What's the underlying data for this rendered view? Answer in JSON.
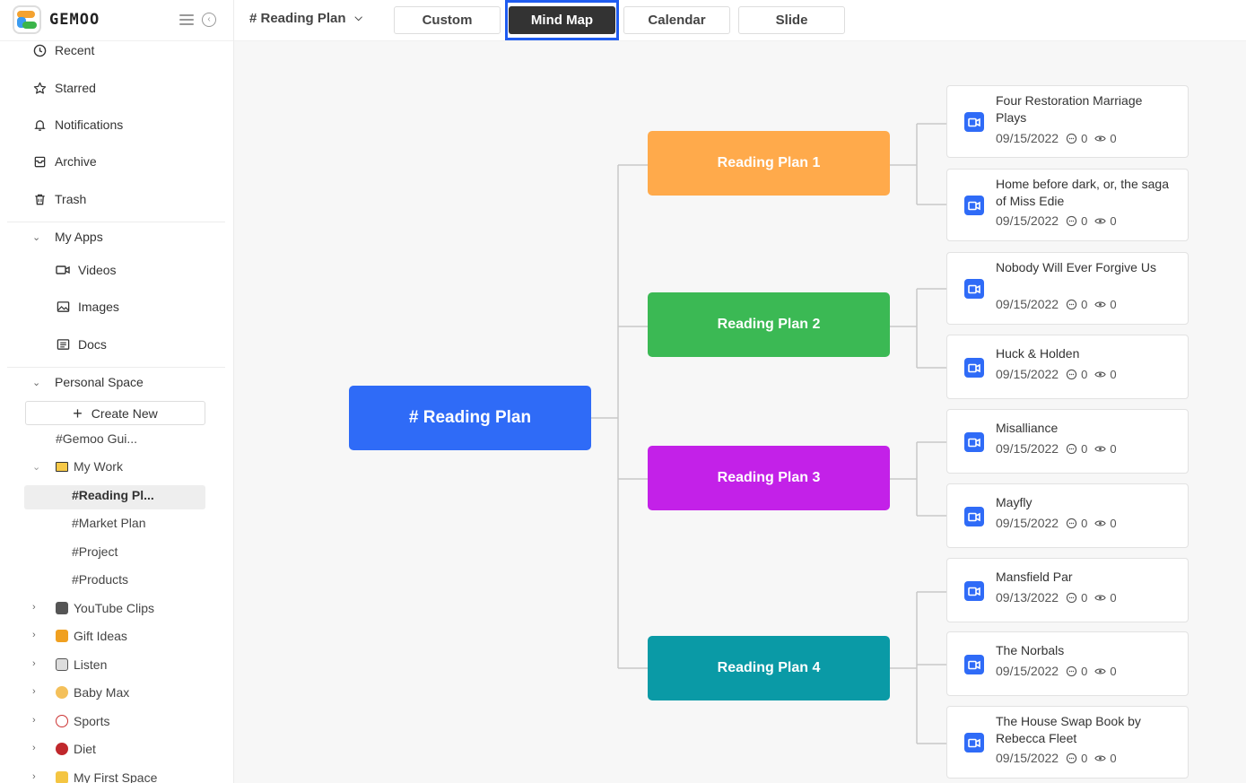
{
  "app": {
    "logo_text": "GEMOO"
  },
  "sidebar": {
    "nav": [
      {
        "label": "Recent",
        "icon": "clock-icon"
      },
      {
        "label": "Starred",
        "icon": "star-icon"
      },
      {
        "label": "Notifications",
        "icon": "bell-icon"
      },
      {
        "label": "Archive",
        "icon": "archive-icon"
      },
      {
        "label": "Trash",
        "icon": "trash-icon"
      }
    ],
    "my_apps": {
      "label": "My Apps",
      "items": [
        {
          "label": "Videos",
          "icon": "video-icon"
        },
        {
          "label": "Images",
          "icon": "image-icon"
        },
        {
          "label": "Docs",
          "icon": "doc-icon"
        }
      ]
    },
    "personal_space": {
      "label": "Personal Space",
      "create_new": "Create New",
      "tree": [
        {
          "label": "#Gemoo Gui..."
        },
        {
          "label": "My Work",
          "icon": "folder-icon"
        },
        {
          "label": "#Reading Pl...",
          "selected": true
        },
        {
          "label": "#Market Plan"
        },
        {
          "label": "#Project"
        },
        {
          "label": "#Products"
        },
        {
          "label": "YouTube Clips",
          "icon": "film-icon"
        },
        {
          "label": "Gift Ideas",
          "icon": "gift-icon"
        },
        {
          "label": "Listen",
          "icon": "radio-icon"
        },
        {
          "label": "Baby Max",
          "icon": "cat-icon"
        },
        {
          "label": "Sports",
          "icon": "ball-icon"
        },
        {
          "label": "Diet",
          "icon": "cherry-icon"
        },
        {
          "label": "My First Space",
          "icon": "hand-icon"
        }
      ]
    }
  },
  "topbar": {
    "doc_title": "# Reading Plan",
    "tabs": [
      {
        "label": "Custom"
      },
      {
        "label": "Mind Map",
        "active": true
      },
      {
        "label": "Calendar"
      },
      {
        "label": "Slide"
      }
    ]
  },
  "mindmap": {
    "root": "# Reading Plan",
    "plans": [
      {
        "label": "Reading Plan 1",
        "color": "#ffaa4b",
        "cards": [
          {
            "title": "Four Restoration Marriage Plays",
            "date": "09/15/2022",
            "comments": "0",
            "views": "0"
          },
          {
            "title": "Home before dark, or, the saga of Miss Edie",
            "date": "09/15/2022",
            "comments": "0",
            "views": "0"
          }
        ]
      },
      {
        "label": "Reading Plan 2",
        "color": "#3bb954",
        "cards": [
          {
            "title": "Nobody Will Ever Forgive Us",
            "date": "09/15/2022",
            "comments": "0",
            "views": "0"
          },
          {
            "title": "Huck & Holden",
            "date": "09/15/2022",
            "comments": "0",
            "views": "0"
          }
        ]
      },
      {
        "label": "Reading Plan 3",
        "color": "#c321e8",
        "cards": [
          {
            "title": "Misalliance",
            "date": "09/15/2022",
            "comments": "0",
            "views": "0"
          },
          {
            "title": "Mayfly",
            "date": "09/15/2022",
            "comments": "0",
            "views": "0"
          }
        ]
      },
      {
        "label": "Reading Plan 4",
        "color": "#0a9aa6",
        "cards": [
          {
            "title": "Mansfield Par",
            "date": "09/13/2022",
            "comments": "0",
            "views": "0"
          },
          {
            "title": "The Norbals",
            "date": "09/15/2022",
            "comments": "0",
            "views": "0"
          },
          {
            "title": "The House Swap Book by Rebecca Fleet",
            "date": "09/15/2022",
            "comments": "0",
            "views": "0"
          }
        ]
      }
    ]
  }
}
